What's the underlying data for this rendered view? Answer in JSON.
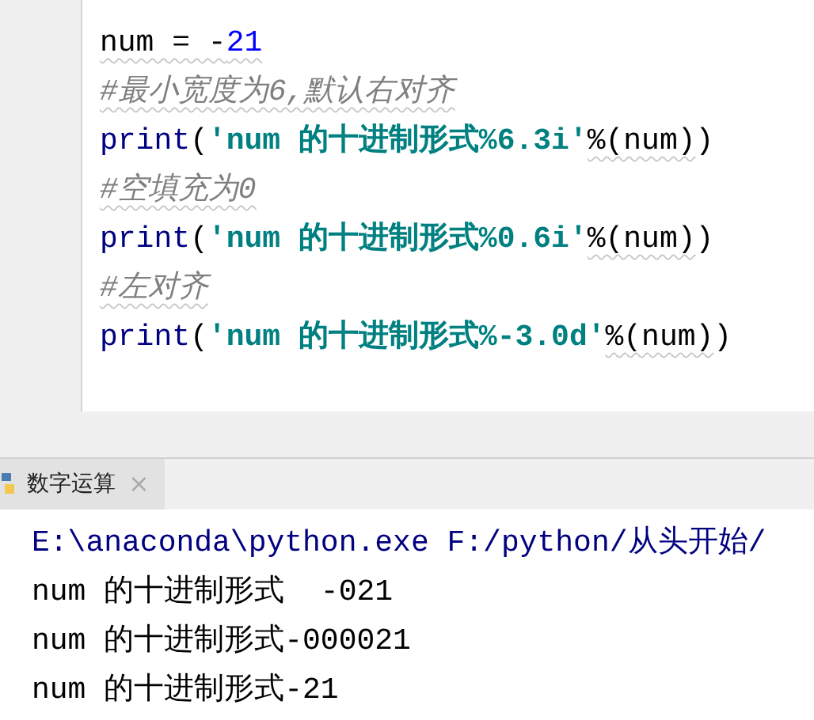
{
  "editor": {
    "lines": [
      [
        {
          "text": "num = -",
          "kind": "plain",
          "squiggly": true
        },
        {
          "text": "21",
          "kind": "number",
          "squiggly": true
        }
      ],
      [
        {
          "text": "#最小宽度为6,默认右对齐",
          "kind": "comment",
          "squiggly": true
        }
      ],
      [
        {
          "text": "print",
          "kind": "builtin",
          "squiggly": false
        },
        {
          "text": "(",
          "kind": "plain",
          "squiggly": false
        },
        {
          "text": "'num 的十进制形式%6.3i'",
          "kind": "string",
          "squiggly": false
        },
        {
          "text": "%(num)",
          "kind": "plain",
          "squiggly": true
        },
        {
          "text": ")",
          "kind": "plain",
          "squiggly": false
        }
      ],
      [
        {
          "text": "#空填充为0",
          "kind": "comment",
          "squiggly": true
        }
      ],
      [
        {
          "text": "print",
          "kind": "builtin",
          "squiggly": false
        },
        {
          "text": "(",
          "kind": "plain",
          "squiggly": false
        },
        {
          "text": "'num 的十进制形式%0.6i'",
          "kind": "string",
          "squiggly": false
        },
        {
          "text": "%(num)",
          "kind": "plain",
          "squiggly": true
        },
        {
          "text": ")",
          "kind": "plain",
          "squiggly": false
        }
      ],
      [
        {
          "text": "#左对齐",
          "kind": "comment",
          "squiggly": true
        }
      ],
      [
        {
          "text": "print",
          "kind": "builtin",
          "squiggly": false
        },
        {
          "text": "(",
          "kind": "plain",
          "squiggly": false
        },
        {
          "text": "'num 的十进制形式%-3.0d'",
          "kind": "string",
          "squiggly": false
        },
        {
          "text": "%(num)",
          "kind": "plain",
          "squiggly": true
        },
        {
          "text": ")",
          "kind": "plain",
          "squiggly": false
        }
      ]
    ]
  },
  "run_tab": {
    "label": "数字运算",
    "close": "×"
  },
  "output": [
    {
      "text": "E:\\anaconda\\python.exe F:/python/从头开始/",
      "kind": "command"
    },
    {
      "text": "num 的十进制形式  -021",
      "kind": "stdout"
    },
    {
      "text": "num 的十进制形式-000021",
      "kind": "stdout"
    },
    {
      "text": "num 的十进制形式-21",
      "kind": "stdout"
    }
  ]
}
